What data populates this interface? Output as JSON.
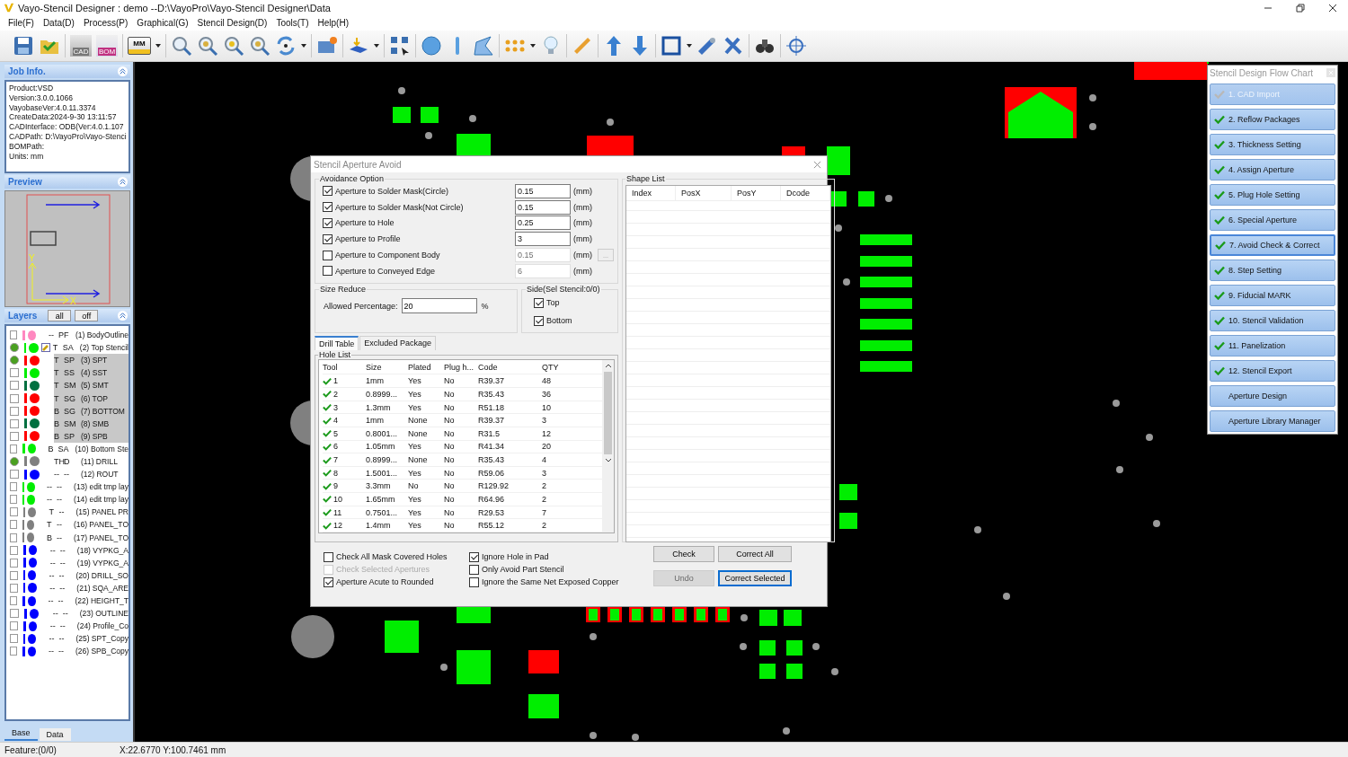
{
  "window": {
    "title": "Vayo-Stencil Designer : demo  --D:\\VayoPro\\Vayo-Stencil Designer\\Data"
  },
  "menu": [
    "File(F)",
    "Data(D)",
    "Process(P)",
    "Graphical(G)",
    "Stencil Design(D)",
    "Tools(T)",
    "Help(H)"
  ],
  "toolbar": {
    "cad_label": "CAD",
    "bom_label": "BOM",
    "unit_label": "MM"
  },
  "job_info": {
    "title": "Job Info.",
    "lines": [
      "Product:VSD",
      "Version:3.0.0.1066",
      "VayobaseVer:4.0.11.3374",
      "CreateData:2024-9-30 13:11:57",
      "CADInterface: ODB(Ver:4.0.1.107",
      "CADPath: D:\\VayoPro\\Vayo-Stenci",
      "BOMPath:",
      "Units: mm"
    ]
  },
  "preview": {
    "title": "Preview",
    "axis_x": "X",
    "axis_y": "Y"
  },
  "layers": {
    "title": "Layers",
    "buttons": [
      "all",
      "off"
    ],
    "items": [
      {
        "side": "--",
        "type": "PF",
        "name": "(1) BodyOutline",
        "color": "#ff88c0",
        "on": false,
        "selected": false,
        "editing": false
      },
      {
        "side": "T",
        "type": "SA",
        "name": "(2) Top Stencil",
        "color": "#00ee00",
        "on": true,
        "selected": false,
        "editing": true
      },
      {
        "side": "T",
        "type": "SP",
        "name": "(3) SPT",
        "color": "#ff0000",
        "on": true,
        "selected": true,
        "editing": false
      },
      {
        "side": "T",
        "type": "SS",
        "name": "(4) SST",
        "color": "#00ee00",
        "on": false,
        "selected": true,
        "editing": false
      },
      {
        "side": "T",
        "type": "SM",
        "name": "(5) SMT",
        "color": "#007040",
        "on": false,
        "selected": true,
        "editing": false
      },
      {
        "side": "T",
        "type": "SG",
        "name": "(6) TOP",
        "color": "#ff0000",
        "on": false,
        "selected": true,
        "editing": false
      },
      {
        "side": "B",
        "type": "SG",
        "name": "(7) BOTTOM",
        "color": "#ff0000",
        "on": false,
        "selected": true,
        "editing": false
      },
      {
        "side": "B",
        "type": "SM",
        "name": "(8) SMB",
        "color": "#007040",
        "on": false,
        "selected": true,
        "editing": false
      },
      {
        "side": "B",
        "type": "SP",
        "name": "(9) SPB",
        "color": "#ff0000",
        "on": false,
        "selected": true,
        "editing": false
      },
      {
        "side": "B",
        "type": "SA",
        "name": "(10) Bottom Ste",
        "color": "#00ee00",
        "on": false,
        "selected": false,
        "editing": false
      },
      {
        "side": "TH",
        "type": "D",
        "name": "(11) DRILL",
        "color": "#808080",
        "on": true,
        "selected": false,
        "editing": false
      },
      {
        "side": "--",
        "type": "--",
        "name": "(12) ROUT",
        "color": "#0000ff",
        "on": false,
        "selected": false,
        "editing": false
      },
      {
        "side": "--",
        "type": "--",
        "name": "(13) edit tmp lay",
        "color": "#00ee00",
        "on": false,
        "selected": false,
        "editing": false
      },
      {
        "side": "--",
        "type": "--",
        "name": "(14) edit tmp lay",
        "color": "#00ee00",
        "on": false,
        "selected": false,
        "editing": false
      },
      {
        "side": "T",
        "type": "--",
        "name": "(15) PANEL PR",
        "color": "#808080",
        "on": false,
        "selected": false,
        "editing": false
      },
      {
        "side": "T",
        "type": "--",
        "name": "(16) PANEL_TO",
        "color": "#808080",
        "on": false,
        "selected": false,
        "editing": false
      },
      {
        "side": "B",
        "type": "--",
        "name": "(17) PANEL_TO",
        "color": "#808080",
        "on": false,
        "selected": false,
        "editing": false
      },
      {
        "side": "--",
        "type": "--",
        "name": "(18) VYPKG_A",
        "color": "#0000ff",
        "on": false,
        "selected": false,
        "editing": false
      },
      {
        "side": "--",
        "type": "--",
        "name": "(19) VYPKG_A",
        "color": "#0000ff",
        "on": false,
        "selected": false,
        "editing": false
      },
      {
        "side": "--",
        "type": "--",
        "name": "(20) DRILL_SO",
        "color": "#0000ff",
        "on": false,
        "selected": false,
        "editing": false
      },
      {
        "side": "--",
        "type": "--",
        "name": "(21) SQA_ARE",
        "color": "#0000ff",
        "on": false,
        "selected": false,
        "editing": false
      },
      {
        "side": "--",
        "type": "--",
        "name": "(22) HEIGHT_T",
        "color": "#0000ff",
        "on": false,
        "selected": false,
        "editing": false
      },
      {
        "side": "--",
        "type": "--",
        "name": "(23) OUTLINE",
        "color": "#0000ff",
        "on": false,
        "selected": false,
        "editing": false
      },
      {
        "side": "--",
        "type": "--",
        "name": "(24) Profile_Co",
        "color": "#0000ff",
        "on": false,
        "selected": false,
        "editing": false
      },
      {
        "side": "--",
        "type": "--",
        "name": "(25) SPT_Copy",
        "color": "#0000ff",
        "on": false,
        "selected": false,
        "editing": false
      },
      {
        "side": "--",
        "type": "--",
        "name": "(26) SPB_Copy",
        "color": "#0000ff",
        "on": false,
        "selected": false,
        "editing": false
      }
    ]
  },
  "bottom_tabs": [
    {
      "label": "Base",
      "selected": true
    },
    {
      "label": "Data",
      "selected": false
    }
  ],
  "dialog": {
    "title": "Stencil Aperture Avoid",
    "avoidance": {
      "title": "Avoidance Option",
      "options": [
        {
          "label": "Aperture to Solder Mask(Circle)",
          "checked": true,
          "value": "0.15",
          "unit": "(mm)",
          "disabled": false
        },
        {
          "label": "Aperture to Solder Mask(Not Circle)",
          "checked": true,
          "value": "0.15",
          "unit": "(mm)",
          "disabled": false
        },
        {
          "label": "Aperture to Hole",
          "checked": true,
          "value": "0.25",
          "unit": "(mm)",
          "disabled": false
        },
        {
          "label": "Aperture to Profile",
          "checked": true,
          "value": "3",
          "unit": "(mm)",
          "disabled": false
        },
        {
          "label": "Aperture to Component Body",
          "checked": false,
          "value": "0.15",
          "unit": "(mm)",
          "disabled": true,
          "more": "..."
        },
        {
          "label": "Aperture to Conveyed Edge",
          "checked": false,
          "value": "6",
          "unit": "(mm)",
          "disabled": true
        }
      ]
    },
    "size_reduce": {
      "title": "Size Reduce",
      "label": "Allowed Percentage:",
      "value": "20",
      "unit": "%"
    },
    "side": {
      "title": "Side(Sel Stencil:0/0)",
      "options": [
        {
          "label": "Top",
          "checked": true
        },
        {
          "label": "Bottom",
          "checked": true
        }
      ]
    },
    "tabs": [
      {
        "label": "Drill Table",
        "selected": true
      },
      {
        "label": "Excluded Package",
        "selected": false
      }
    ],
    "hole_list": {
      "title": "Hole List",
      "columns": [
        "Tool",
        "Size",
        "Plated",
        "Plug h...",
        "Code",
        "QTY"
      ],
      "rows": [
        {
          "done": true,
          "cells": [
            "1",
            "1mm",
            "Yes",
            "No",
            "R39.37",
            "48"
          ]
        },
        {
          "done": true,
          "cells": [
            "2",
            "0.8999...",
            "Yes",
            "No",
            "R35.43",
            "36"
          ]
        },
        {
          "done": true,
          "cells": [
            "3",
            "1.3mm",
            "Yes",
            "No",
            "R51.18",
            "10"
          ]
        },
        {
          "done": true,
          "cells": [
            "4",
            "1mm",
            "None",
            "No",
            "R39.37",
            "3"
          ]
        },
        {
          "done": true,
          "cells": [
            "5",
            "0.8001...",
            "None",
            "No",
            "R31.5",
            "12"
          ]
        },
        {
          "done": true,
          "cells": [
            "6",
            "1.05mm",
            "Yes",
            "No",
            "R41.34",
            "20"
          ]
        },
        {
          "done": true,
          "cells": [
            "7",
            "0.8999...",
            "None",
            "No",
            "R35.43",
            "4"
          ]
        },
        {
          "done": true,
          "cells": [
            "8",
            "1.5001...",
            "Yes",
            "No",
            "R59.06",
            "3"
          ]
        },
        {
          "done": true,
          "cells": [
            "9",
            "3.3mm",
            "No",
            "No",
            "R129.92",
            "2"
          ]
        },
        {
          "done": true,
          "cells": [
            "10",
            "1.65mm",
            "Yes",
            "No",
            "R64.96",
            "2"
          ]
        },
        {
          "done": true,
          "cells": [
            "11",
            "0.7501...",
            "Yes",
            "No",
            "R29.53",
            "7"
          ]
        },
        {
          "done": true,
          "cells": [
            "12",
            "1.4mm",
            "Yes",
            "No",
            "R55.12",
            "2"
          ]
        }
      ]
    },
    "shape_list": {
      "title": "Shape List",
      "columns": [
        "Index",
        "PosX",
        "PosY",
        "Dcode"
      ]
    },
    "options_left": [
      {
        "label": "Check All Mask Covered Holes",
        "checked": false,
        "disabled": false
      },
      {
        "label": "Check Selected Apertures",
        "checked": false,
        "disabled": true
      },
      {
        "label": "Aperture Acute to Rounded",
        "checked": true,
        "disabled": false
      }
    ],
    "options_right": [
      {
        "label": "Ignore Hole in Pad",
        "checked": true,
        "disabled": false
      },
      {
        "label": "Only Avoid Part Stencil",
        "checked": false,
        "disabled": false
      },
      {
        "label": "Ignore the Same Net Exposed Copper",
        "checked": false,
        "disabled": false
      }
    ],
    "buttons": [
      {
        "label": "Check",
        "disabled": false,
        "selected": false
      },
      {
        "label": "Correct All",
        "disabled": false,
        "selected": false
      },
      {
        "label": "Undo",
        "disabled": true,
        "selected": false
      },
      {
        "label": "Correct Selected",
        "disabled": false,
        "selected": true
      }
    ]
  },
  "flow_chart": {
    "title": "Stencil Design Flow Chart",
    "items": [
      {
        "label": "1. CAD Import",
        "done": true,
        "disabled": true,
        "selected": false
      },
      {
        "label": "2. Reflow Packages",
        "done": true,
        "disabled": false,
        "selected": false
      },
      {
        "label": "3. Thickness Setting",
        "done": true,
        "disabled": false,
        "selected": false
      },
      {
        "label": "4. Assign Aperture",
        "done": true,
        "disabled": false,
        "selected": false
      },
      {
        "label": "5. Plug Hole Setting",
        "done": true,
        "disabled": false,
        "selected": false
      },
      {
        "label": "6. Special Aperture",
        "done": true,
        "disabled": false,
        "selected": false
      },
      {
        "label": "7. Avoid Check & Correct",
        "done": true,
        "disabled": false,
        "selected": true
      },
      {
        "label": "8. Step Setting",
        "done": true,
        "disabled": false,
        "selected": false
      },
      {
        "label": "9. Fiducial MARK",
        "done": true,
        "disabled": false,
        "selected": false
      },
      {
        "label": "10. Stencil Validation",
        "done": true,
        "disabled": false,
        "selected": false
      },
      {
        "label": "11. Panelization",
        "done": true,
        "disabled": false,
        "selected": false
      },
      {
        "label": "12. Stencil Export",
        "done": true,
        "disabled": false,
        "selected": false
      },
      {
        "label": "Aperture Design",
        "done": false,
        "disabled": false,
        "selected": false
      },
      {
        "label": "Aperture Library Manager",
        "done": false,
        "disabled": false,
        "selected": false
      }
    ]
  },
  "status_bar": {
    "feature": "Feature:(0/0)",
    "coords": "X:22.6770 Y:100.7461 mm"
  }
}
